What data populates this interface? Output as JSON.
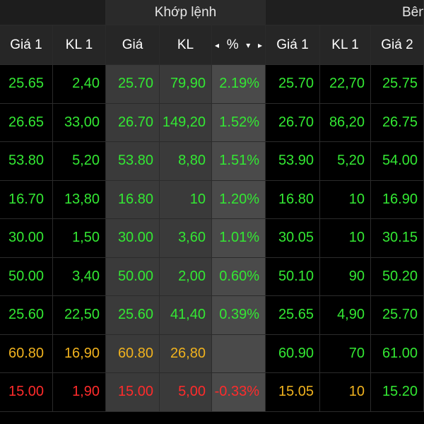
{
  "header": {
    "groups": [
      "",
      "Khớp lệnh",
      "Bên"
    ],
    "columns": [
      "Giá 1",
      "KL 1",
      "Giá",
      "KL",
      "%",
      "Giá 1",
      "KL 1",
      "Giá 2"
    ],
    "sort_icons": {
      "left": "◂",
      "sort": "▾",
      "right": "▸"
    }
  },
  "colors": {
    "up": "#33e833",
    "reference": "#f0b21e",
    "down": "#ff2b2b"
  },
  "rows": [
    {
      "cells": [
        "25.65",
        "2,40",
        "25.70",
        "79,90",
        "2.19%",
        "25.70",
        "22,70",
        "25.75"
      ],
      "status": [
        "green",
        "green",
        "green",
        "green",
        "green",
        "green",
        "green",
        "green"
      ]
    },
    {
      "cells": [
        "26.65",
        "33,00",
        "26.70",
        "149,20",
        "1.52%",
        "26.70",
        "86,20",
        "26.75"
      ],
      "status": [
        "green",
        "green",
        "green",
        "green",
        "green",
        "green",
        "green",
        "green"
      ]
    },
    {
      "cells": [
        "53.80",
        "5,20",
        "53.80",
        "8,80",
        "1.51%",
        "53.90",
        "5,20",
        "54.00"
      ],
      "status": [
        "green",
        "green",
        "green",
        "green",
        "green",
        "green",
        "green",
        "green"
      ]
    },
    {
      "cells": [
        "16.70",
        "13,80",
        "16.80",
        "10",
        "1.20%",
        "16.80",
        "10",
        "16.90"
      ],
      "status": [
        "green",
        "green",
        "green",
        "green",
        "green",
        "green",
        "green",
        "green"
      ]
    },
    {
      "cells": [
        "30.00",
        "1,50",
        "30.00",
        "3,60",
        "1.01%",
        "30.05",
        "10",
        "30.15"
      ],
      "status": [
        "green",
        "green",
        "green",
        "green",
        "green",
        "green",
        "green",
        "green"
      ]
    },
    {
      "cells": [
        "50.00",
        "3,40",
        "50.00",
        "2,00",
        "0.60%",
        "50.10",
        "90",
        "50.20"
      ],
      "status": [
        "green",
        "green",
        "green",
        "green",
        "green",
        "green",
        "green",
        "green"
      ]
    },
    {
      "cells": [
        "25.60",
        "22,50",
        "25.60",
        "41,40",
        "0.39%",
        "25.65",
        "4,90",
        "25.70"
      ],
      "status": [
        "green",
        "green",
        "green",
        "green",
        "green",
        "green",
        "green",
        "green"
      ]
    },
    {
      "cells": [
        "60.80",
        "16,90",
        "60.80",
        "26,80",
        "",
        "60.90",
        "70",
        "61.00"
      ],
      "status": [
        "yellow",
        "yellow",
        "yellow",
        "yellow",
        "yellow",
        "green",
        "green",
        "green"
      ]
    },
    {
      "cells": [
        "15.00",
        "1,90",
        "15.00",
        "5,00",
        "-0.33%",
        "15.05",
        "10",
        "15.20"
      ],
      "status": [
        "red",
        "red",
        "red",
        "red",
        "red",
        "yellow",
        "yellow",
        "green"
      ]
    }
  ]
}
